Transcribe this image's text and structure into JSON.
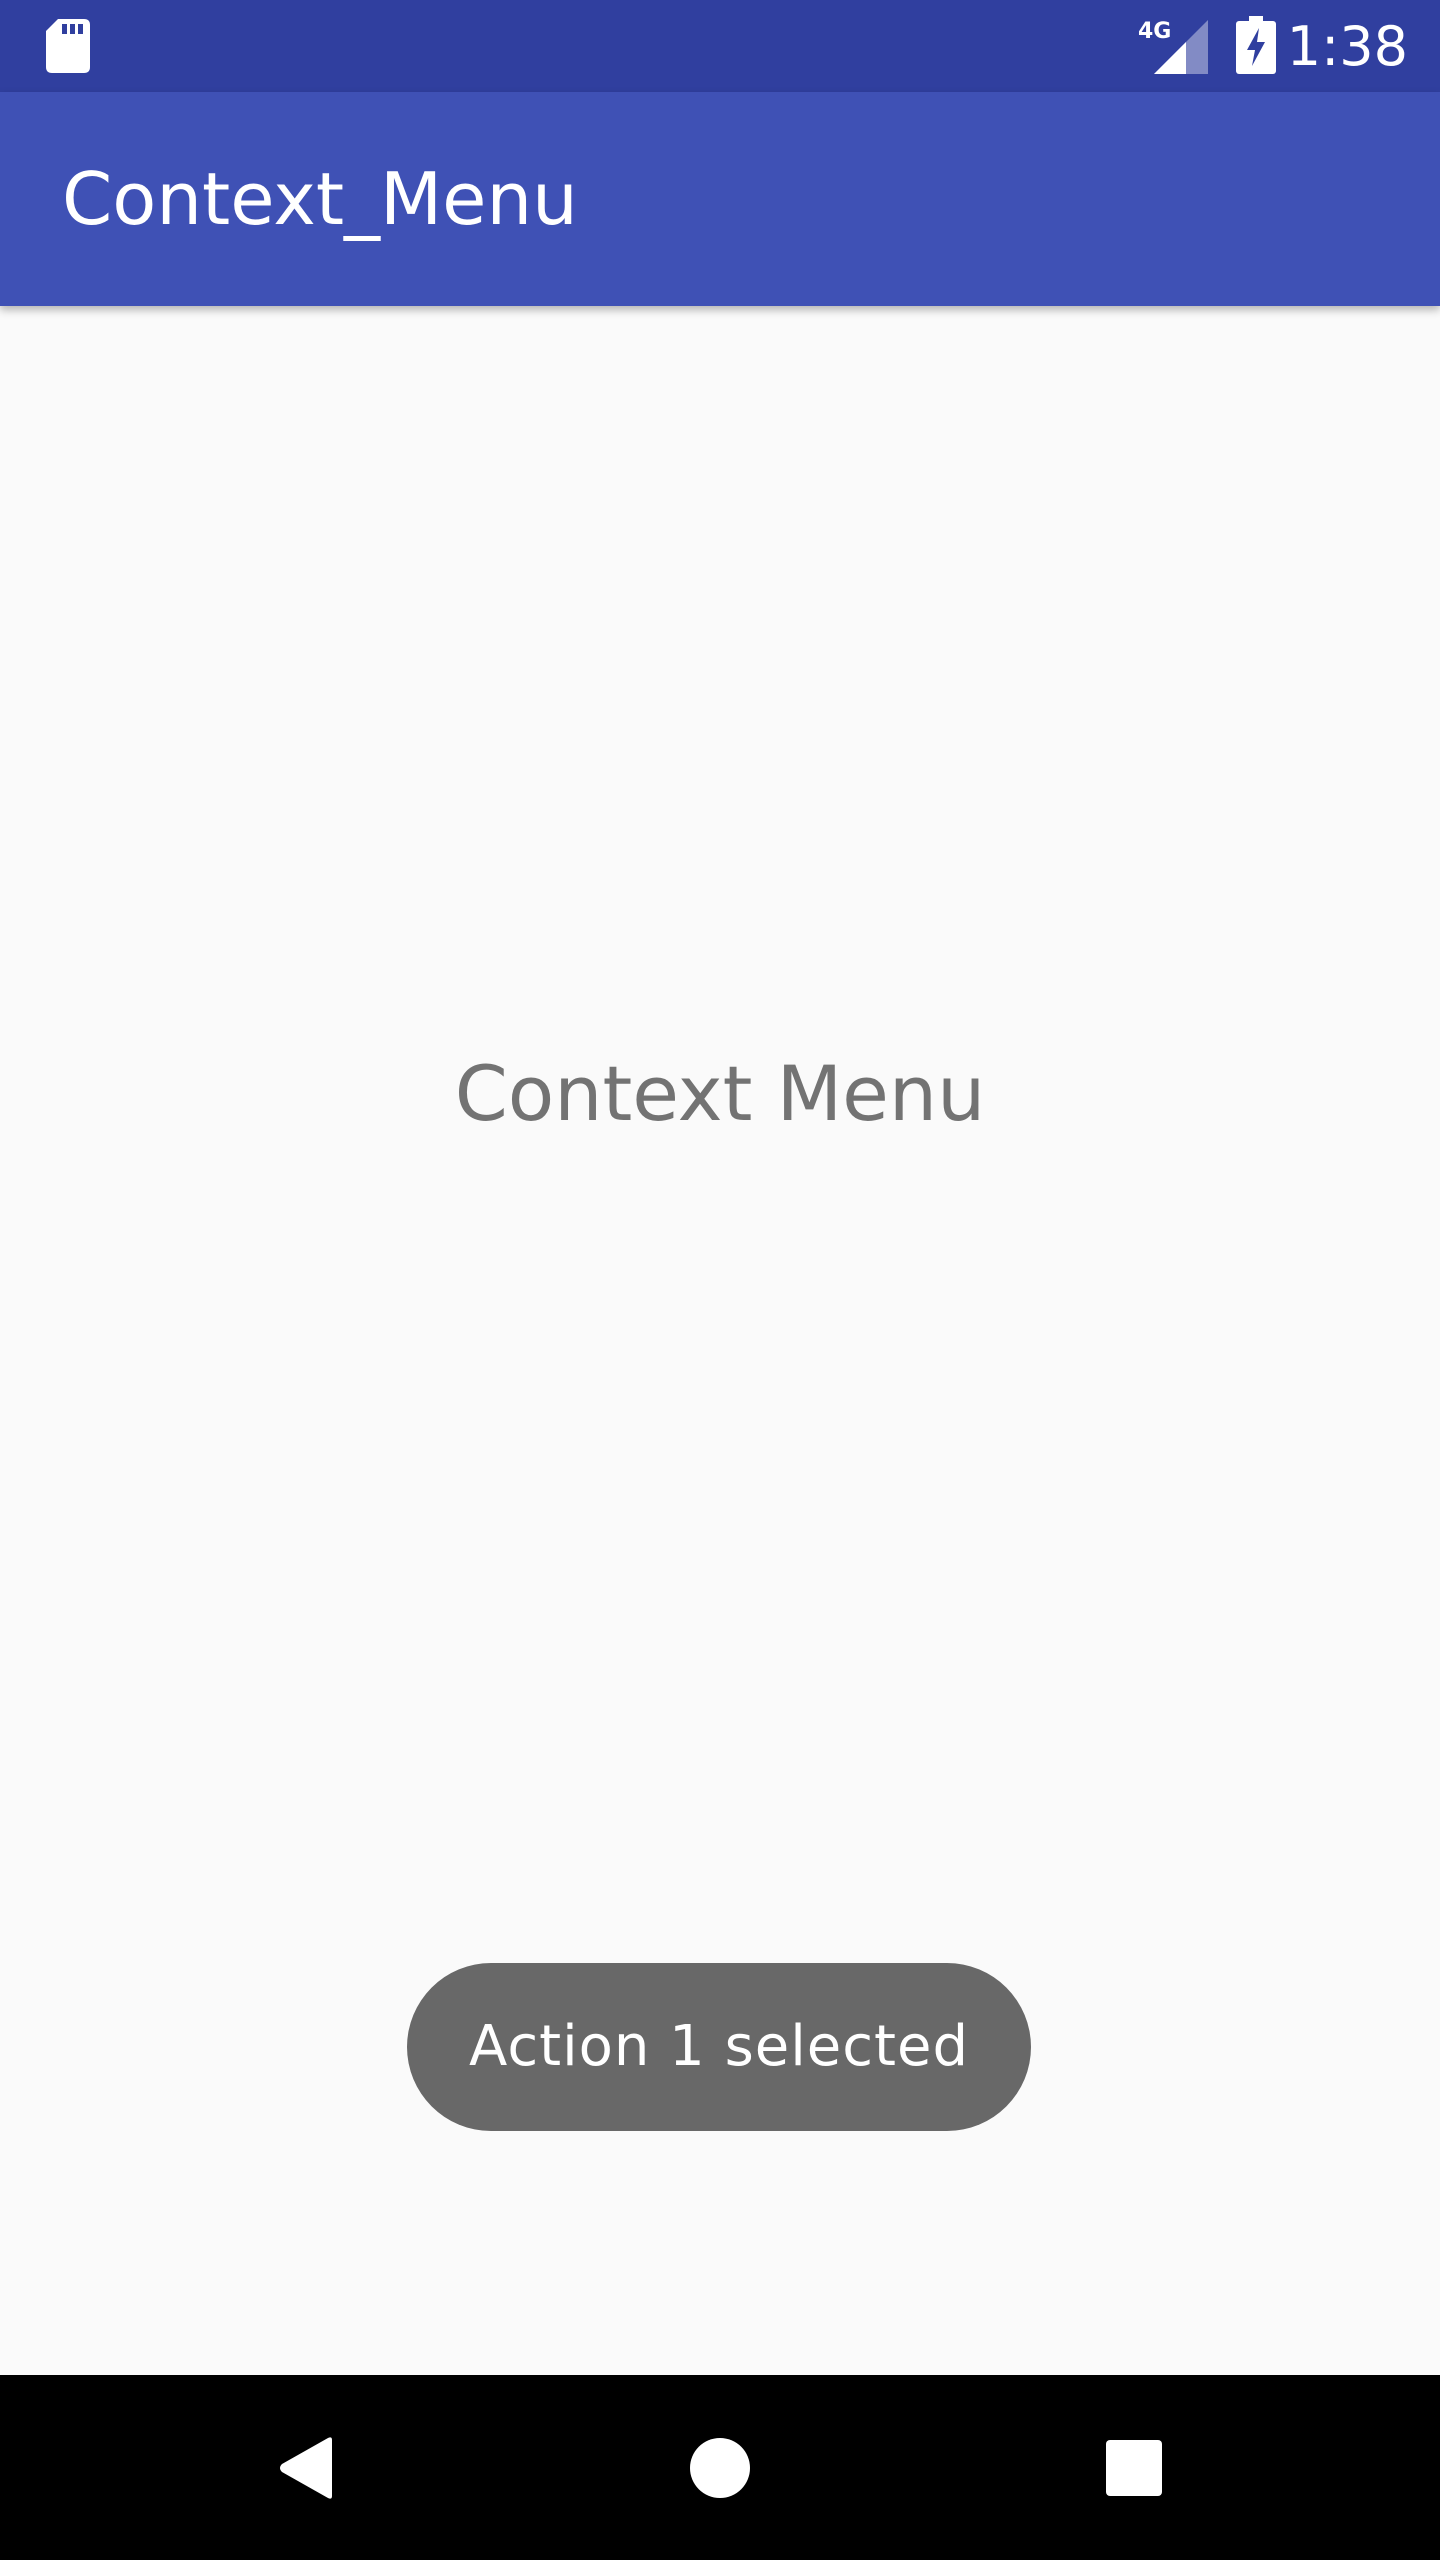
{
  "status_bar": {
    "time": "1:38",
    "network_label": "4G",
    "icons": [
      "sd-card-icon",
      "cellular-signal-icon",
      "battery-charging-icon"
    ]
  },
  "app_bar": {
    "title": "Context_Menu"
  },
  "main": {
    "center_text": "Context Menu"
  },
  "toast": {
    "message": "Action 1  selected"
  },
  "nav_bar": {
    "buttons": [
      "back-icon",
      "home-icon",
      "recents-icon"
    ]
  },
  "colors": {
    "status_bar": "#303f9f",
    "app_bar": "#3f51b5",
    "background": "#fafafa",
    "toast": "#686868",
    "nav_bar": "#000000"
  }
}
